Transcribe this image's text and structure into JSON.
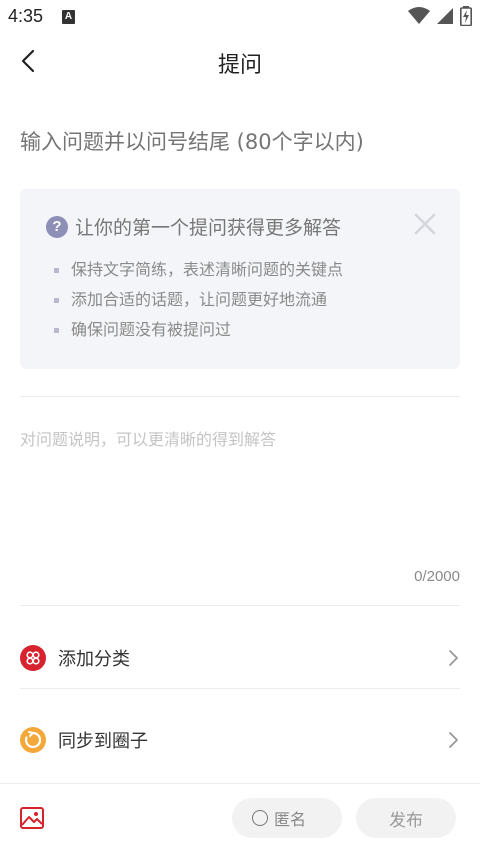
{
  "status_bar": {
    "time": "4:35",
    "notification_badge": "A",
    "icons": [
      "wifi-icon",
      "signal-icon",
      "battery-icon"
    ]
  },
  "nav": {
    "title": "提问",
    "back_icon": "chevron-left-icon"
  },
  "question": {
    "placeholder": "输入问题并以问号结尾 (80个字以内)"
  },
  "tips": {
    "title": "让你的第一个提问获得更多解答",
    "items": [
      "保持文字简练，表述清晰问题的关键点",
      "添加合适的话题，让问题更好地流通",
      "确保问题没有被提问过"
    ],
    "colors": {
      "background": "#f4f5f9",
      "accent": "#8d8fb6"
    }
  },
  "description": {
    "placeholder": "对问题说明，可以更清晰的得到解答",
    "counter": "0/2000"
  },
  "options": [
    {
      "label": "添加分类",
      "icon": "category-grid-icon",
      "color": "#d6232e"
    },
    {
      "label": "同步到圈子",
      "icon": "circle-sync-icon",
      "color": "#f4a73a"
    }
  ],
  "bottom_bar": {
    "image_icon": "image-icon",
    "anonymous_label": "匿名",
    "publish_label": "发布"
  }
}
